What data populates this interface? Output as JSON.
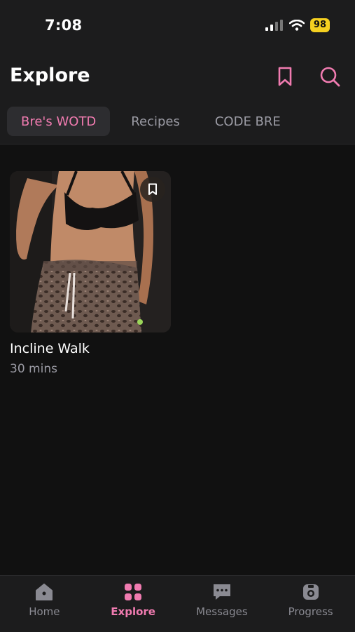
{
  "status": {
    "time": "7:08",
    "battery": "98"
  },
  "header": {
    "title": "Explore"
  },
  "tabs": [
    {
      "label": "Bre's WOTD",
      "active": true
    },
    {
      "label": "Recipes",
      "active": false
    },
    {
      "label": "CODE BRE",
      "active": false
    }
  ],
  "workout": {
    "title": "Incline Walk",
    "duration": "30 mins"
  },
  "nav": [
    {
      "label": "Home",
      "icon": "home-icon"
    },
    {
      "label": "Explore",
      "icon": "grid-icon",
      "active": true
    },
    {
      "label": "Messages",
      "icon": "message-icon"
    },
    {
      "label": "Progress",
      "icon": "camera-icon"
    }
  ],
  "colors": {
    "accent": "#f07bb0",
    "background": "#111111",
    "surface": "#1c1c1d",
    "muted": "#9b9ba4"
  }
}
